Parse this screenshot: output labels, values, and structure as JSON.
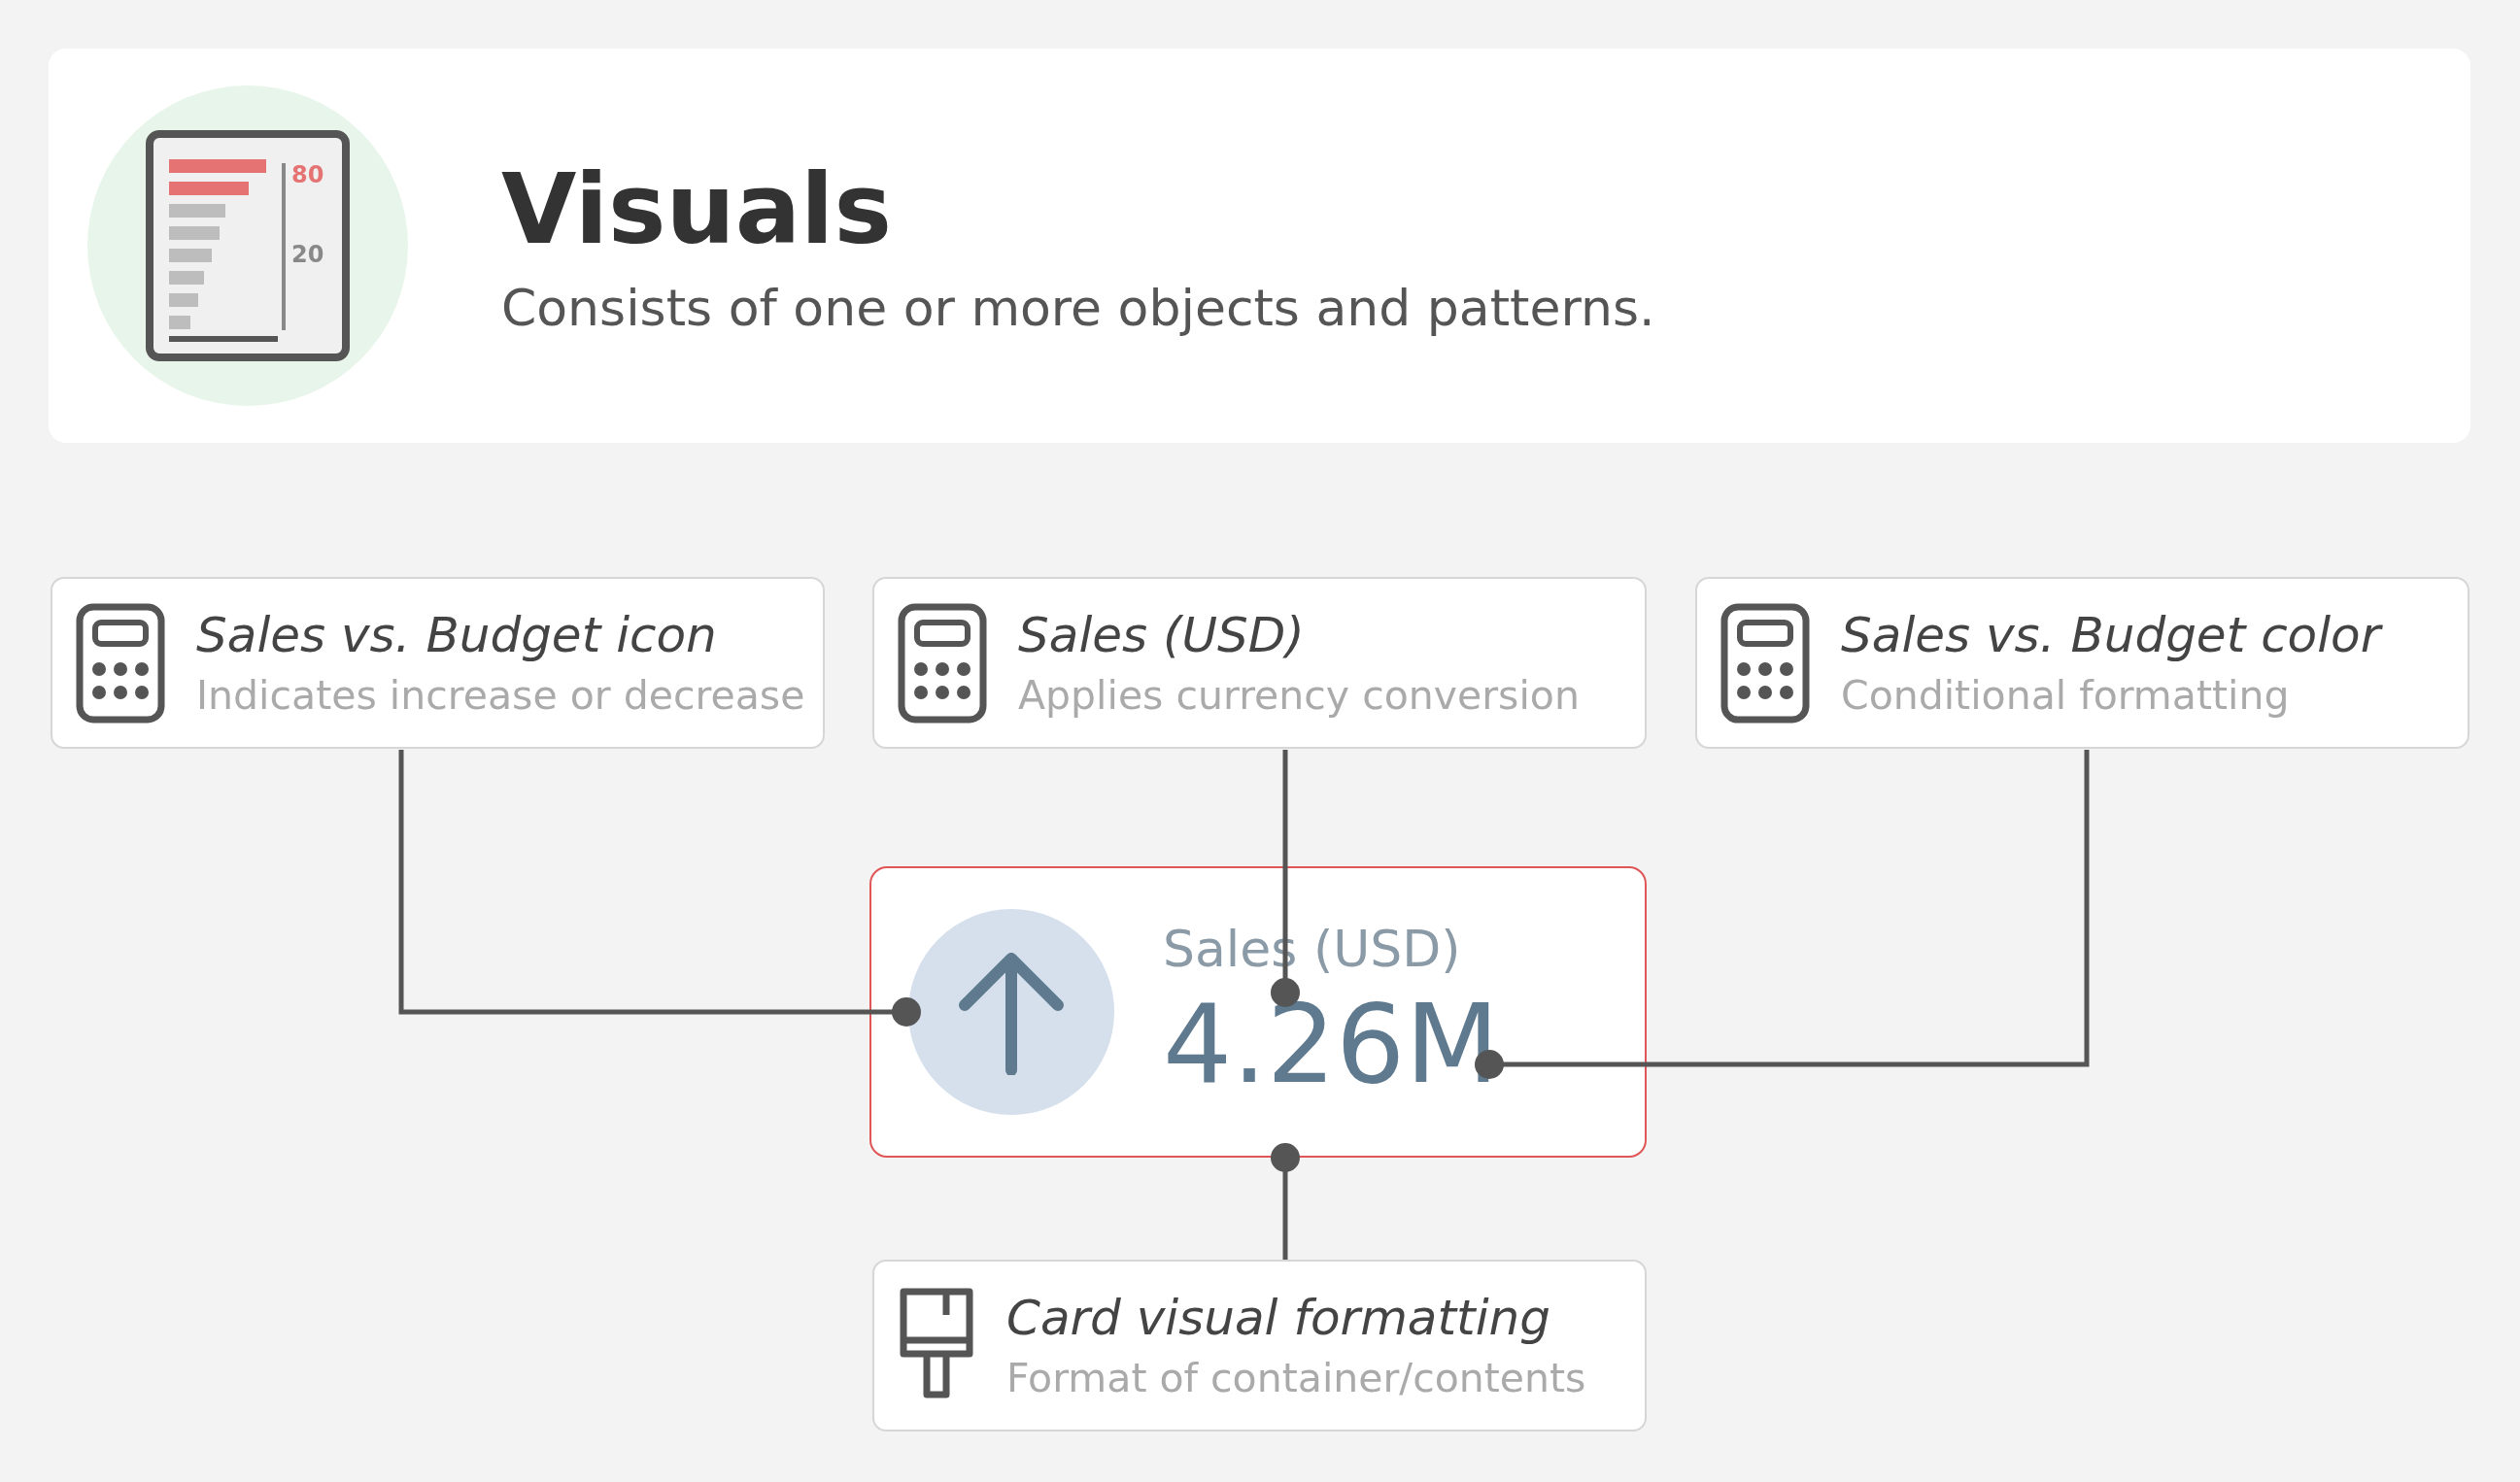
{
  "header": {
    "title": "Visuals",
    "subtitle": "Consists of one or more objects and patterns.",
    "icon_labels": [
      "80",
      "20"
    ]
  },
  "sources": [
    {
      "kind": "calculator",
      "title": "Sales vs. Budget icon",
      "subtitle": "Indicates increase or decrease"
    },
    {
      "kind": "calculator",
      "title": "Sales (USD)",
      "subtitle": "Applies currency conversion"
    },
    {
      "kind": "calculator",
      "title": "Sales vs. Budget color",
      "subtitle": "Conditional formatting"
    }
  ],
  "card": {
    "label": "Sales (USD)",
    "value": "4.26M"
  },
  "formatting": {
    "kind": "brush",
    "title": "Card visual formatting",
    "subtitle": "Format of container/contents"
  }
}
